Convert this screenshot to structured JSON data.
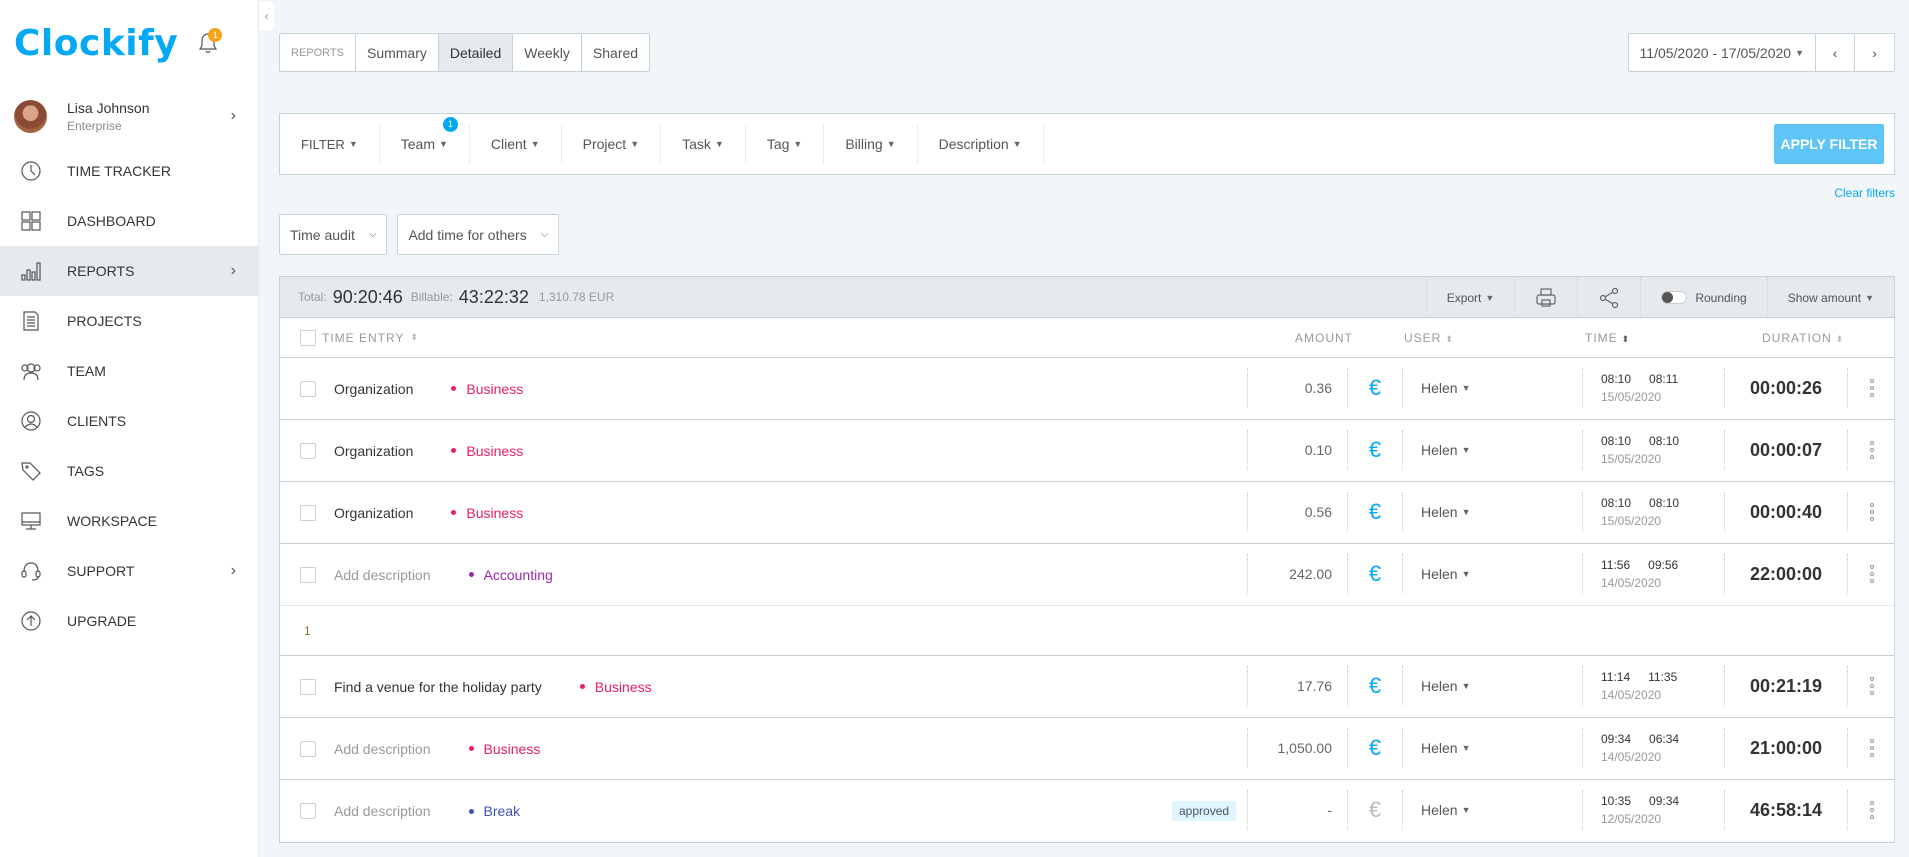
{
  "app": {
    "logo": "Clockify",
    "notification_count": "1"
  },
  "user": {
    "name": "Lisa Johnson",
    "plan": "Enterprise"
  },
  "sidebar": {
    "items": [
      {
        "label": "TIME TRACKER",
        "icon": "clock-icon"
      },
      {
        "label": "DASHBOARD",
        "icon": "grid-icon"
      },
      {
        "label": "REPORTS",
        "icon": "bar-chart-icon",
        "active": true
      },
      {
        "label": "PROJECTS",
        "icon": "document-icon"
      },
      {
        "label": "TEAM",
        "icon": "team-icon"
      },
      {
        "label": "CLIENTS",
        "icon": "client-icon"
      },
      {
        "label": "TAGS",
        "icon": "tag-icon"
      },
      {
        "label": "WORKSPACE",
        "icon": "monitor-icon"
      },
      {
        "label": "SUPPORT",
        "icon": "headset-icon"
      },
      {
        "label": "UPGRADE",
        "icon": "upgrade-icon"
      }
    ]
  },
  "report_tabs": {
    "label": "REPORTS",
    "tabs": [
      "Summary",
      "Detailed",
      "Weekly",
      "Shared"
    ],
    "active": "Detailed"
  },
  "date_range": {
    "value": "11/05/2020 - 17/05/2020"
  },
  "filters": {
    "items": [
      "FILTER",
      "Team",
      "Client",
      "Project",
      "Task",
      "Tag",
      "Billing",
      "Description"
    ],
    "team_badge": "1",
    "apply_label": "APPLY FILTER",
    "clear_label": "Clear filters"
  },
  "dropdowns": {
    "time_audit": "Time audit",
    "add_time": "Add time for others"
  },
  "summary": {
    "total_label": "Total:",
    "total": "90:20:46",
    "billable_label": "Billable:",
    "billable": "43:22:32",
    "amount": "1,310.78 EUR",
    "export": "Export",
    "rounding": "Rounding",
    "show_amount": "Show amount"
  },
  "columns": {
    "entry": "TIME ENTRY",
    "amount": "AMOUNT",
    "user": "USER",
    "time": "TIME",
    "duration": "DURATION"
  },
  "colors": {
    "accent": "#03a9f4",
    "business": "#e91e63",
    "accounting": "#9c27b0",
    "break": "#3f51b5"
  },
  "entries": [
    {
      "description": "Organization",
      "placeholder": false,
      "project": "Business",
      "color": "#e91e63",
      "amount": "0.36",
      "billable": true,
      "user": "Helen",
      "start": "08:10",
      "end": "08:11",
      "date": "15/05/2020",
      "duration": "00:00:26"
    },
    {
      "description": "Organization",
      "placeholder": false,
      "project": "Business",
      "color": "#e91e63",
      "amount": "0.10",
      "billable": true,
      "user": "Helen",
      "start": "08:10",
      "end": "08:10",
      "date": "15/05/2020",
      "duration": "00:00:07"
    },
    {
      "description": "Organization",
      "placeholder": false,
      "project": "Business",
      "color": "#e91e63",
      "amount": "0.56",
      "billable": true,
      "user": "Helen",
      "start": "08:10",
      "end": "08:10",
      "date": "15/05/2020",
      "duration": "00:00:40"
    },
    {
      "description": "Add description",
      "placeholder": true,
      "project": "Accounting",
      "color": "#9c27b0",
      "amount": "242.00",
      "billable": true,
      "user": "Helen",
      "start": "11:56",
      "end": "09:56",
      "date": "14/05/2020",
      "duration": "22:00:00",
      "group_count": "1"
    },
    {
      "description": "Find a venue for the holiday party",
      "placeholder": false,
      "project": "Business",
      "color": "#e91e63",
      "amount": "17.76",
      "billable": true,
      "user": "Helen",
      "start": "11:14",
      "end": "11:35",
      "date": "14/05/2020",
      "duration": "00:21:19"
    },
    {
      "description": "Add description",
      "placeholder": true,
      "project": "Business",
      "color": "#e91e63",
      "amount": "1,050.00",
      "billable": true,
      "user": "Helen",
      "start": "09:34",
      "end": "06:34",
      "date": "14/05/2020",
      "duration": "21:00:00"
    },
    {
      "description": "Add description",
      "placeholder": true,
      "project": "Break",
      "color": "#3f51b5",
      "amount": "-",
      "billable": false,
      "user": "Helen",
      "start": "10:35",
      "end": "09:34",
      "date": "12/05/2020",
      "duration": "46:58:14",
      "status": "approved"
    }
  ]
}
